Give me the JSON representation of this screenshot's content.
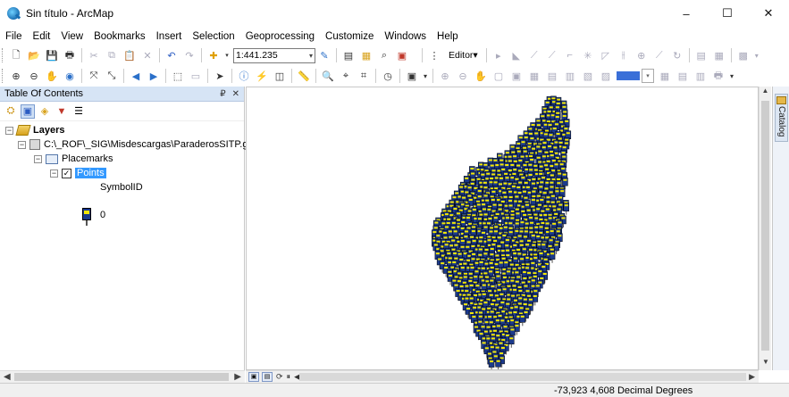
{
  "window": {
    "title": "Sin título - ArcMap",
    "controls": {
      "minimize": "–",
      "maximize": "☐",
      "close": "✕"
    }
  },
  "menubar": {
    "items": [
      "File",
      "Edit",
      "View",
      "Bookmarks",
      "Insert",
      "Selection",
      "Geoprocessing",
      "Customize",
      "Windows",
      "Help"
    ]
  },
  "toolbar": {
    "scale_value": "1:441.235",
    "editor_label": "Editor▾"
  },
  "toc": {
    "title": "Table Of Contents",
    "pin": "₽",
    "close": "✕",
    "layers_label": "Layers",
    "source_path": "C:\\_ROF\\_SIG\\Misdescargas\\ParaderosSITP.g",
    "placemarks_label": "Placemarks",
    "points_label": "Points",
    "points_checked": true,
    "field_label": "SymbolID",
    "legend_value": "0"
  },
  "map": {
    "symbol_colors": {
      "body": "#1b3a8c",
      "band": "#f5e800",
      "stem": "#555555"
    }
  },
  "catalog": {
    "label": "Catalog"
  },
  "status": {
    "coordinates": "-73,923 4,608 Decimal Degrees"
  }
}
